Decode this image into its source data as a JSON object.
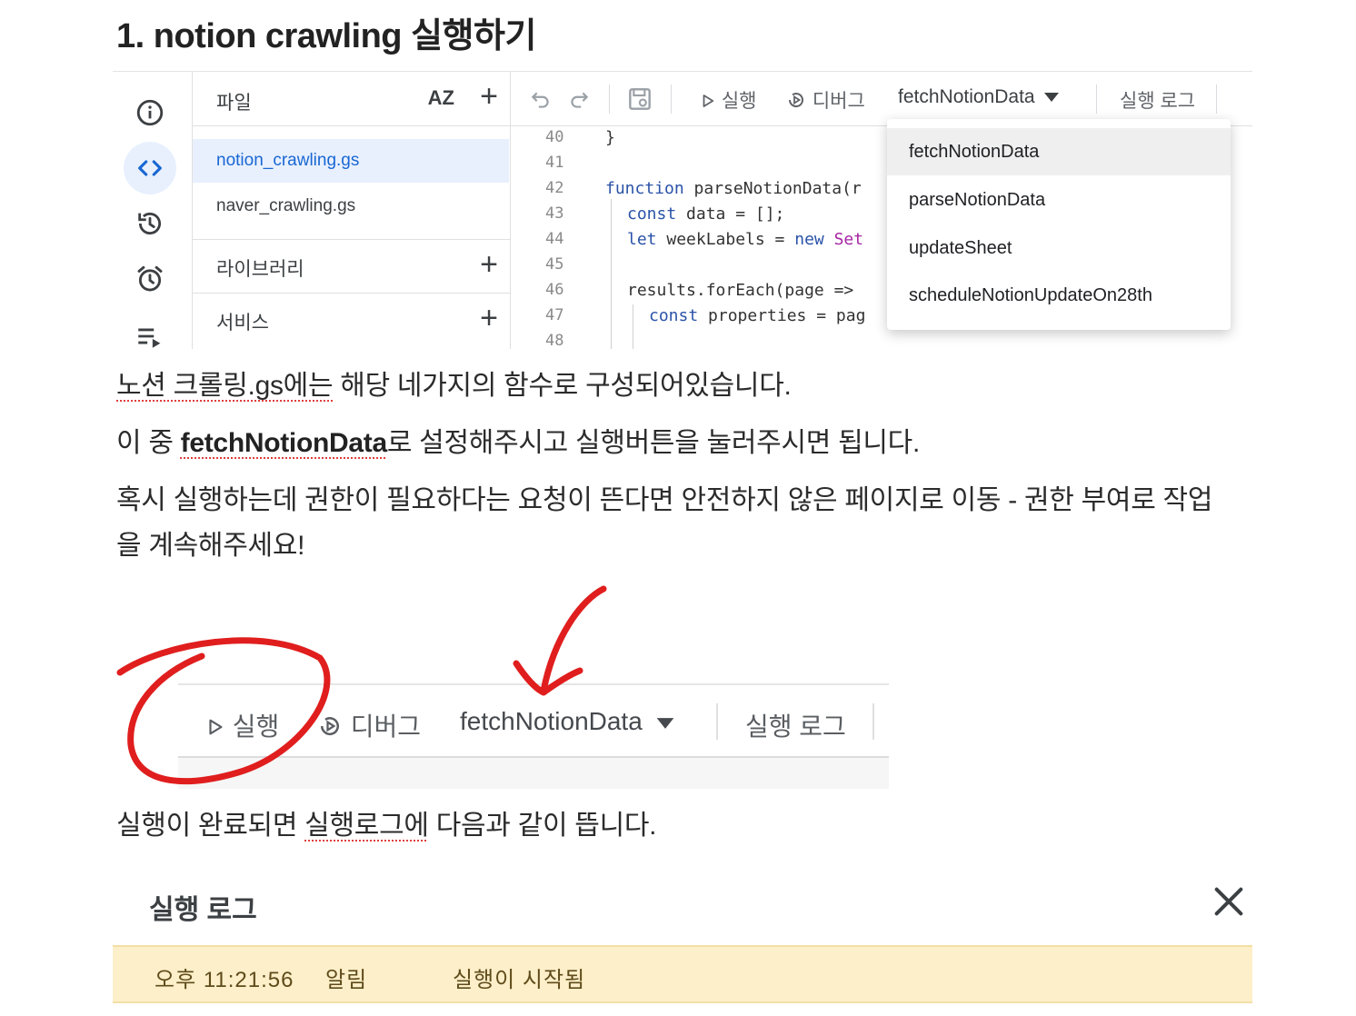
{
  "heading": "1. notion crawling 실행하기",
  "editor": {
    "files_title": "파일",
    "sort_label": "AZ",
    "files": [
      "notion_crawling.gs",
      "naver_crawling.gs"
    ],
    "libraries_label": "라이브러리",
    "services_label": "서비스",
    "toolbar": {
      "run_label": "실행",
      "debug_label": "디버그",
      "function_select": "fetchNotionData",
      "log_label": "실행 로그"
    },
    "line_numbers": [
      "40",
      "41",
      "42",
      "43",
      "44",
      "45",
      "46",
      "47",
      "48"
    ],
    "code_lines": {
      "l40": "}",
      "l42_kw": "function",
      "l42_rest": " parseNotionData(r",
      "l43_kw": "const",
      "l43_rest": " data = [];",
      "l44_kw": "let",
      "l44_mid": " weekLabels = ",
      "l44_kw2": "new",
      "l44_end": " Set",
      "l46": "results.forEach(page =>",
      "l47_kw": "const",
      "l47_rest": " properties = pag"
    },
    "dropdown_options": [
      "fetchNotionData",
      "parseNotionData",
      "updateSheet",
      "scheduleNotionUpdateOn28th"
    ]
  },
  "para1": {
    "squiggle": "노션 크롤링.gs에는",
    "rest": " 해당 네가지의 함수로 구성되어있습니다."
  },
  "para2": {
    "prefix": "이 중 ",
    "bold": "fetchNotionData",
    "rest": "로 설정해주시고 실행버튼을 눌러주시면 됩니다."
  },
  "para3": {
    "line1": "혹시 실행하는데 권한이 필요하다는 요청이 뜬다면 안전하지 않은 페이지로 이동 - 권한 부여로 작업",
    "line2": "을 계속해주세요!"
  },
  "toolbar_zoom": {
    "run_label": "실행",
    "debug_label": "디버그",
    "function_select": "fetchNotionData",
    "log_label": "실행 로그"
  },
  "para4": {
    "prefix": "실행이 완료되면 ",
    "squiggle": "실행로그에",
    "rest": " 다음과 같이 뜹니다."
  },
  "log": {
    "title": "실행 로그",
    "time": "오후 11:21:56",
    "type": "알림",
    "message": "실행이 시작됨"
  },
  "colors": {
    "accent_blue": "#1967d2",
    "active_bg": "#e8f0fe",
    "annotation_red": "#e01e1e",
    "log_row_bg": "#fcefc9"
  }
}
